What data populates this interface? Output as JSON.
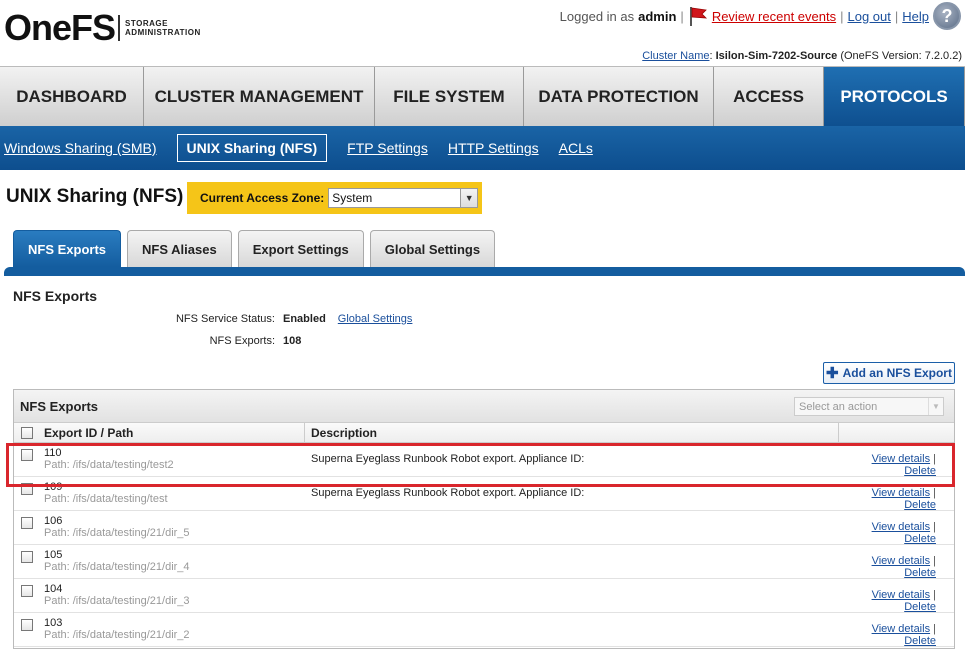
{
  "brand": {
    "name": "OneFS",
    "subtitle": "STORAGE ADMINISTRATION"
  },
  "header": {
    "logged_in_prefix": "Logged in as",
    "user": "admin",
    "review_events": "Review recent events",
    "logout": "Log out",
    "help": "Help",
    "help_icon": "?",
    "cluster_label": "Cluster Name",
    "cluster_name": "Isilon-Sim-7202-Source",
    "version": "(OneFS Version: 7.2.0.2)"
  },
  "main_nav": [
    {
      "label": "DASHBOARD",
      "active": false
    },
    {
      "label": "CLUSTER MANAGEMENT",
      "active": false
    },
    {
      "label": "FILE SYSTEM",
      "active": false
    },
    {
      "label": "DATA PROTECTION",
      "active": false
    },
    {
      "label": "ACCESS",
      "active": false
    },
    {
      "label": "PROTOCOLS",
      "active": true
    }
  ],
  "sub_nav": [
    {
      "label": "Windows Sharing (SMB)"
    },
    {
      "label": "UNIX Sharing (NFS)",
      "current": true
    },
    {
      "label": "FTP Settings"
    },
    {
      "label": "HTTP Settings"
    },
    {
      "label": "ACLs"
    }
  ],
  "page": {
    "title": "UNIX Sharing (NFS)",
    "zone_label": "Current Access Zone:",
    "zone_value": "System"
  },
  "tabs": [
    {
      "label": "NFS Exports",
      "active": true
    },
    {
      "label": "NFS Aliases"
    },
    {
      "label": "Export Settings"
    },
    {
      "label": "Global Settings"
    }
  ],
  "section": {
    "title": "NFS Exports",
    "service_status_label": "NFS Service Status:",
    "service_status_value": "Enabled",
    "global_settings_link": "Global Settings",
    "exports_count_label": "NFS Exports:",
    "exports_count_value": "108",
    "add_button": "Add an NFS Export"
  },
  "table": {
    "title": "NFS Exports",
    "action_placeholder": "Select an action",
    "columns": [
      "Export ID / Path",
      "Description"
    ],
    "view_label": "View details",
    "delete_label": "Delete",
    "rows": [
      {
        "id": "110",
        "path": "Path: /ifs/data/testing/test2",
        "description": "Superna Eyeglass Runbook Robot export. Appliance ID:"
      },
      {
        "id": "109",
        "path": "Path: /ifs/data/testing/test",
        "description": "Superna Eyeglass Runbook Robot export. Appliance ID:"
      },
      {
        "id": "106",
        "path": "Path: /ifs/data/testing/21/dir_5",
        "description": ""
      },
      {
        "id": "105",
        "path": "Path: /ifs/data/testing/21/dir_4",
        "description": ""
      },
      {
        "id": "104",
        "path": "Path: /ifs/data/testing/21/dir_3",
        "description": ""
      },
      {
        "id": "103",
        "path": "Path: /ifs/data/testing/21/dir_2",
        "description": ""
      }
    ]
  },
  "colors": {
    "accent": "#145d9f",
    "zone_bg": "#f5c518",
    "highlight": "#d9262c",
    "flag": "#d0161c"
  }
}
